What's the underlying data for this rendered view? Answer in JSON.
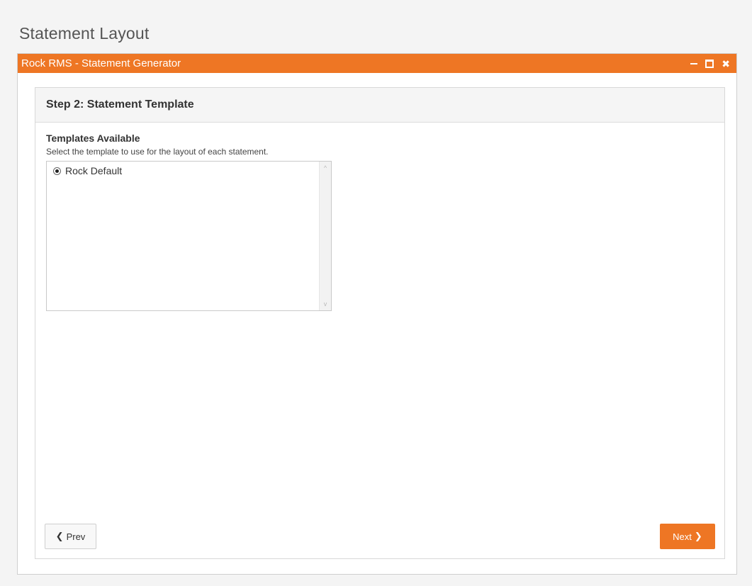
{
  "page": {
    "title": "Statement Layout"
  },
  "window": {
    "title": "Rock RMS - Statement Generator",
    "controls": {
      "minimize_icon": "minimize-icon",
      "maximize_icon": "maximize-icon",
      "close_icon": "close-icon",
      "close_glyph": "✖"
    },
    "accent_color": "#ee7624"
  },
  "panel": {
    "heading": "Step 2: Statement Template",
    "field_label": "Templates Available",
    "help_text": "Select the template to use for the layout of each statement.",
    "templates": [
      {
        "label": "Rock Default",
        "selected": true
      }
    ],
    "scroll_up_glyph": "^",
    "scroll_down_glyph": "v"
  },
  "buttons": {
    "prev_label": "Prev",
    "prev_icon": "❮",
    "next_label": "Next",
    "next_icon": "❯"
  }
}
